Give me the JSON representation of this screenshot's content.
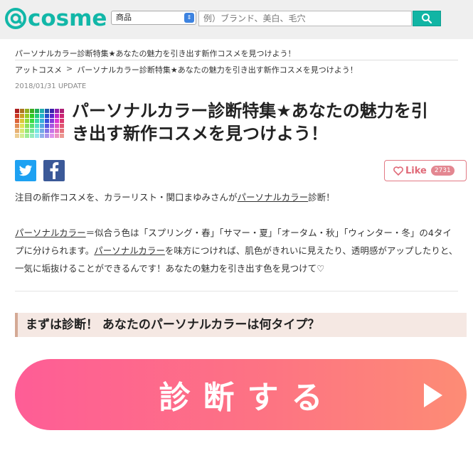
{
  "header": {
    "logo_text": "cosme",
    "search_category": "商品",
    "search_placeholder": "例）ブランド、美白、毛穴",
    "search_icon": "search-icon"
  },
  "article": {
    "lead": "パーソナルカラー診断特集★あなたの魅力を引き出す新作コスメを見つけよう！",
    "breadcrumb": {
      "home": "アットコスメ",
      "separator": ">",
      "current": "パーソナルカラー診断特集★あなたの魅力を引き出す新作コスメを見つけよう！"
    },
    "date": "2018/01/31 UPDATE",
    "title_line1": "パーソナルカラー診断特集★あなたの魅力を引",
    "title_line2": "き出す新作コスメを見つけよう！",
    "like": {
      "label": "Like",
      "count": "2731"
    },
    "para1": {
      "before": "注目の新作コスメを、カラーリスト・関口まゆみさんが",
      "link": "パーソナルカラー",
      "after": "診断！"
    },
    "para2": {
      "link1": "パーソナルカラー",
      "text1": "＝似合う色は「スプリング・春」「サマー・夏」「オータム・秋」「ウィンター・冬」の4タイプに分けられます。",
      "link2": "パーソナルカラー",
      "text2": "を味方につければ、肌色がきれいに見えたり、透明感がアップしたりと、一気に垢抜けることができるんです！あなたの魅力を引き出す色を見つけて♡"
    },
    "section_heading": "まずは診断！ あなたのパーソナルカラーは何タイプ？",
    "diagnose_button": "診断する"
  },
  "colors": {
    "brand": "#12b7a8",
    "like": "#e06a78",
    "button_gradient_start": "#fe5d96",
    "button_gradient_end": "#fd8c75",
    "section_bg": "#f5e8e3"
  }
}
